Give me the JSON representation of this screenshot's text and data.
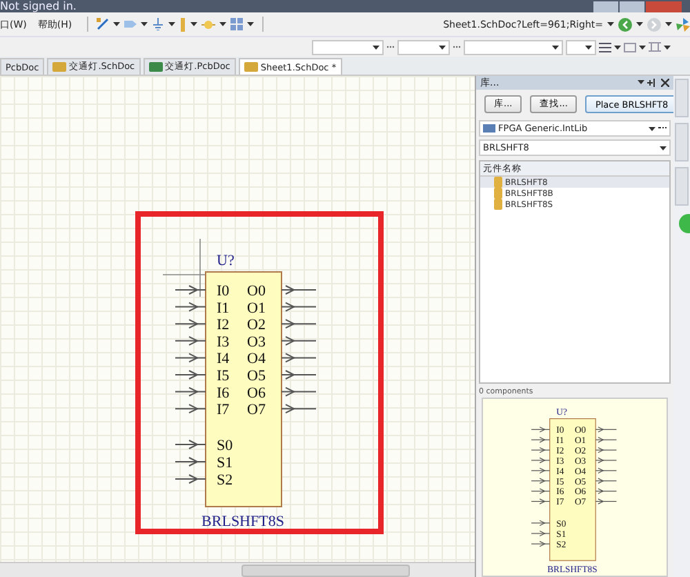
{
  "title_bar": {
    "text": "Not signed in."
  },
  "menu": [
    {
      "label": "口(W)"
    },
    {
      "label": "帮助(H)"
    }
  ],
  "address": {
    "value": "Sheet1.SchDoc?Left=961;Right="
  },
  "tabs": [
    {
      "label": "PcbDoc",
      "selected": false
    },
    {
      "label": "交通灯.SchDoc",
      "kind": "sch",
      "selected": false
    },
    {
      "label": "交通灯.PcbDoc",
      "kind": "pcb",
      "selected": false
    },
    {
      "label": "Sheet1.SchDoc *",
      "kind": "sch",
      "selected": true
    }
  ],
  "component": {
    "designator": "U?",
    "name": "BRLSHFT8S",
    "left_pins": [
      "I0",
      "I1",
      "I2",
      "I3",
      "I4",
      "I5",
      "I6",
      "I7"
    ],
    "right_pins": [
      "O0",
      "O1",
      "O2",
      "O3",
      "O4",
      "O5",
      "O6",
      "O7"
    ],
    "select_pins": [
      "S0",
      "S1",
      "S2"
    ]
  },
  "panel": {
    "title": "库...",
    "buttons": [
      "库...",
      "查找...",
      "Place BRLSHFT8"
    ],
    "library": "FPGA Generic.IntLib",
    "filter": "BRLSHFT8",
    "column": "元件名称",
    "items": [
      {
        "name": "BRLSHFT8",
        "selected": true
      },
      {
        "name": "BRLSHFT8B",
        "selected": false
      },
      {
        "name": "BRLSHFT8S",
        "selected": false
      }
    ],
    "count": "0 components",
    "preview": {
      "designator": "U?",
      "name": "BRLSHFT8S",
      "left_pins": [
        "I0",
        "I1",
        "I2",
        "I3",
        "I4",
        "I5",
        "I6",
        "I7"
      ],
      "right_pins": [
        "O0",
        "O1",
        "O2",
        "O3",
        "O4",
        "O5",
        "O6",
        "O7"
      ],
      "select_pins": [
        "S0",
        "S1",
        "S2"
      ]
    }
  }
}
